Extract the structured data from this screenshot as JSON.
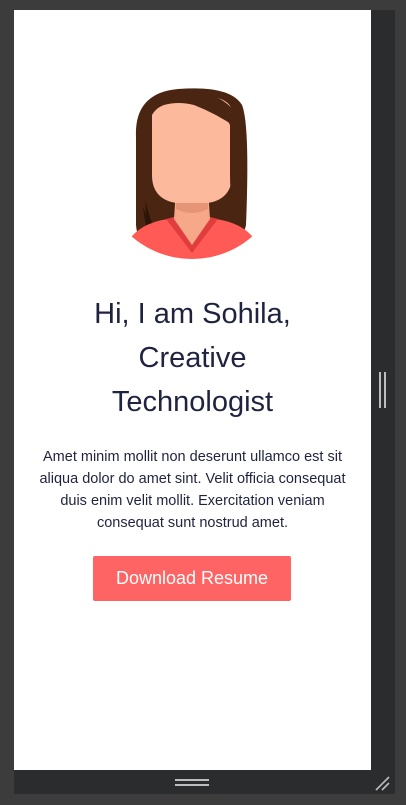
{
  "hero": {
    "title_line1": "Hi, I am Sohila,",
    "title_line2": "Creative",
    "title_line3": "Technologist",
    "description": "Amet minim mollit non deserunt ullamco est sit aliqua dolor do amet sint. Velit officia consequat duis enim velit mollit. Exercitation veniam consequat sunt nostrud amet.",
    "cta_label": "Download Resume"
  },
  "colors": {
    "accent": "#ff6464",
    "heading": "#1f2340",
    "background": "#ffffff",
    "frame": "#3c3c3c"
  },
  "icons": {
    "avatar": "woman-avatar-illustration",
    "vertical_resize": "vertical-resize-handle-icon",
    "horizontal_resize": "horizontal-resize-handle-icon",
    "corner_resize": "corner-resize-grip-icon"
  }
}
